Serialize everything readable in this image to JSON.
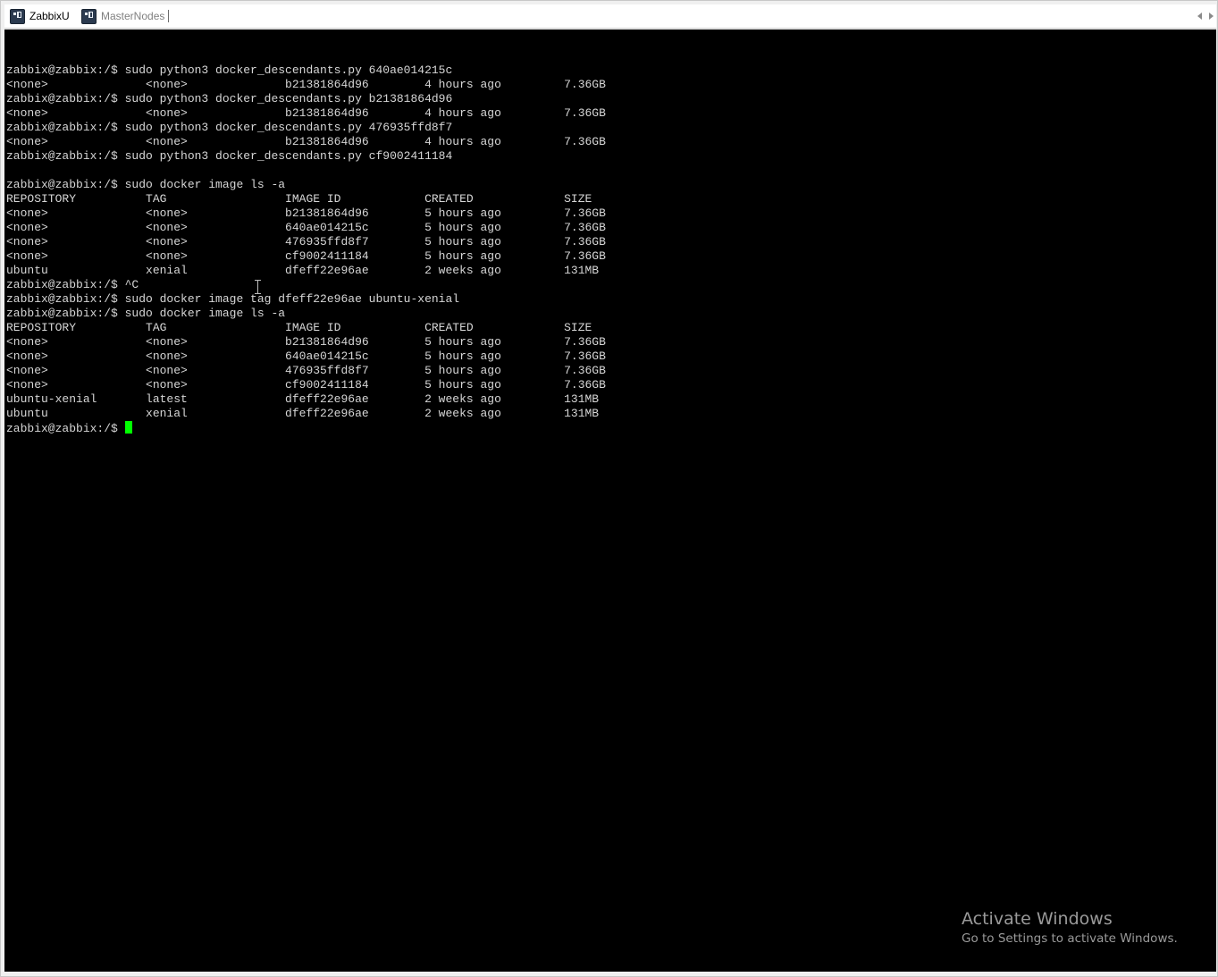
{
  "tabs": [
    {
      "label": "ZabbixU",
      "active": true
    },
    {
      "label": "MasterNodes",
      "active": false
    }
  ],
  "terminal": {
    "background": "#000000",
    "foreground": "#d6d6d6",
    "cursor_color": "#00ff00",
    "lines": [
      "zabbix@zabbix:/$ sudo python3 docker_descendants.py 640ae014215c",
      "<none>              <none>              b21381864d96        4 hours ago         7.36GB",
      "zabbix@zabbix:/$ sudo python3 docker_descendants.py b21381864d96",
      "<none>              <none>              b21381864d96        4 hours ago         7.36GB",
      "zabbix@zabbix:/$ sudo python3 docker_descendants.py 476935ffd8f7",
      "<none>              <none>              b21381864d96        4 hours ago         7.36GB",
      "zabbix@zabbix:/$ sudo python3 docker_descendants.py cf9002411184",
      "",
      "zabbix@zabbix:/$ sudo docker image ls -a",
      "REPOSITORY          TAG                 IMAGE ID            CREATED             SIZE",
      "<none>              <none>              b21381864d96        5 hours ago         7.36GB",
      "<none>              <none>              640ae014215c        5 hours ago         7.36GB",
      "<none>              <none>              476935ffd8f7        5 hours ago         7.36GB",
      "<none>              <none>              cf9002411184        5 hours ago         7.36GB",
      "ubuntu              xenial              dfeff22e96ae        2 weeks ago         131MB",
      "zabbix@zabbix:/$ ^C",
      "zabbix@zabbix:/$ sudo docker image tag dfeff22e96ae ubuntu-xenial",
      "zabbix@zabbix:/$ sudo docker image ls -a",
      "REPOSITORY          TAG                 IMAGE ID            CREATED             SIZE",
      "<none>              <none>              b21381864d96        5 hours ago         7.36GB",
      "<none>              <none>              640ae014215c        5 hours ago         7.36GB",
      "<none>              <none>              476935ffd8f7        5 hours ago         7.36GB",
      "<none>              <none>              cf9002411184        5 hours ago         7.36GB",
      "ubuntu-xenial       latest              dfeff22e96ae        2 weeks ago         131MB",
      "ubuntu              xenial              dfeff22e96ae        2 weeks ago         131MB"
    ],
    "prompt": "zabbix@zabbix:/$ "
  },
  "watermark": {
    "title": "Activate Windows",
    "subtitle": "Go to Settings to activate Windows."
  },
  "icons": {
    "tab_icon": "putty-terminal-icon",
    "scroll_left": "chevron-left-icon",
    "scroll_right": "chevron-right-icon"
  }
}
